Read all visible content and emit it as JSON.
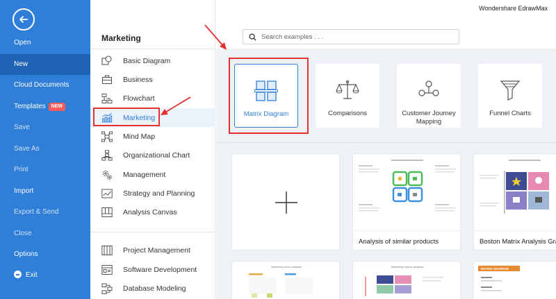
{
  "app": {
    "brand": "Wondershare EdrawMax"
  },
  "leftnav": {
    "items": [
      {
        "label": "Open"
      },
      {
        "label": "New"
      },
      {
        "label": "Cloud Documents"
      },
      {
        "label": "Templates",
        "badge": "NEW"
      },
      {
        "label": "Save"
      },
      {
        "label": "Save As"
      },
      {
        "label": "Print"
      },
      {
        "label": "Import"
      },
      {
        "label": "Export & Send"
      },
      {
        "label": "Close"
      },
      {
        "label": "Options"
      },
      {
        "label": "Exit"
      }
    ],
    "active": "New"
  },
  "categories": {
    "title": "Marketing",
    "items": [
      {
        "label": "Basic Diagram",
        "icon": "basic-diagram-icon"
      },
      {
        "label": "Business",
        "icon": "briefcase-icon"
      },
      {
        "label": "Flowchart",
        "icon": "flowchart-icon"
      },
      {
        "label": "Marketing",
        "icon": "bar-chart-icon"
      },
      {
        "label": "Mind Map",
        "icon": "mind-map-icon"
      },
      {
        "label": "Organizational Chart",
        "icon": "org-chart-icon"
      },
      {
        "label": "Management",
        "icon": "gears-icon"
      },
      {
        "label": "Strategy and Planning",
        "icon": "line-chart-icon"
      },
      {
        "label": "Analysis Canvas",
        "icon": "canvas-icon"
      }
    ],
    "more_items": [
      {
        "label": "Project Management",
        "icon": "project-icon"
      },
      {
        "label": "Software Development",
        "icon": "software-icon"
      },
      {
        "label": "Database Modeling",
        "icon": "database-icon"
      }
    ],
    "selected": "Marketing"
  },
  "search": {
    "placeholder": "Search examples . . ."
  },
  "diagram_types": [
    {
      "label": "Matrix Diagram",
      "icon": "matrix-icon"
    },
    {
      "label": "Comparisons",
      "icon": "scales-icon"
    },
    {
      "label": "Customer Journey Mapping",
      "icon": "journey-icon"
    },
    {
      "label": "Funnel Charts",
      "icon": "funnel-icon"
    }
  ],
  "templates": [
    {
      "label": "",
      "icon": "plus-icon"
    },
    {
      "label": "Analysis of similar products"
    },
    {
      "label": "Boston Matrix Analysis Graph"
    }
  ],
  "templates_row2_titles": [
    "Marketing focus analysis",
    "Marketing market analysis",
    "MATRIX DIAGRAM"
  ],
  "colors": {
    "accent": "#2f7ed8",
    "nav_bg": "#2f7ed8",
    "annotation": "#e53030"
  }
}
